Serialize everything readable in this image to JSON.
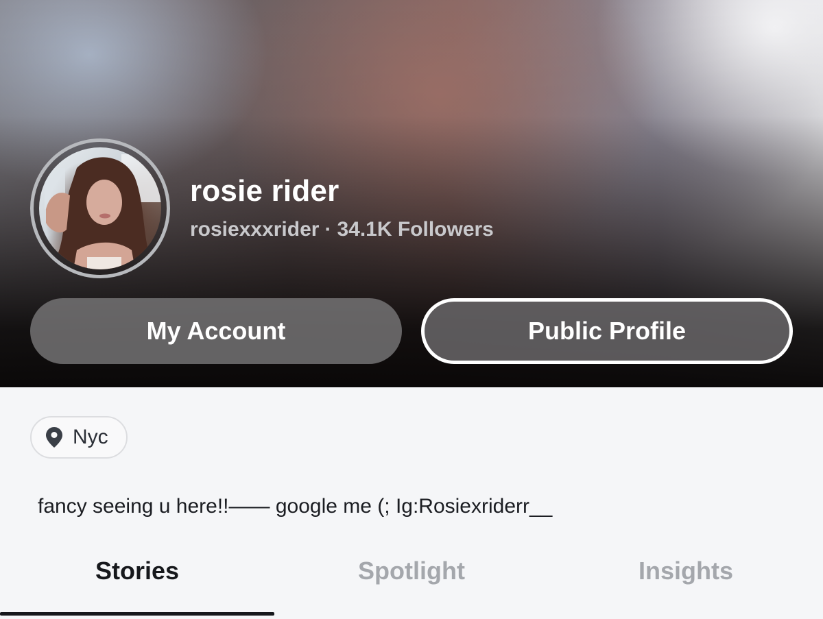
{
  "profile": {
    "display_name": "rosie rider",
    "username": "rosiexxxrider",
    "separator": "·",
    "followers": "34.1K Followers"
  },
  "buttons": {
    "my_account": "My Account",
    "public_profile": "Public Profile"
  },
  "location": {
    "icon": "location-pin-icon",
    "label": "Nyc"
  },
  "bio": "fancy seeing u here!!—— google me (; Ig:Rosiexriderr__",
  "tabs": [
    {
      "label": "Stories",
      "active": true
    },
    {
      "label": "Spotlight",
      "active": false
    },
    {
      "label": "Insights",
      "active": false
    }
  ],
  "colors": {
    "ring": "#b7b9bd",
    "active_tab": "#16181c",
    "inactive_tab": "#a4a7ac",
    "background": "#f5f6f8"
  }
}
